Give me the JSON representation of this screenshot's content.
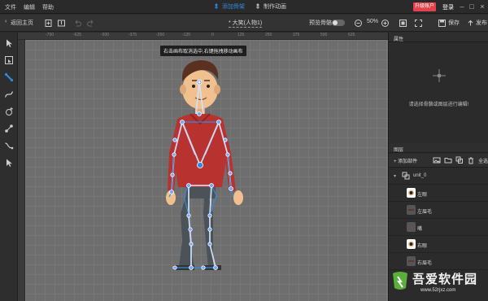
{
  "menu": {
    "file": "文件",
    "edit": "编辑",
    "help": "帮助"
  },
  "modes": {
    "add_skeleton": "添加骨架",
    "make_animation": "制作动画"
  },
  "account": {
    "upgrade": "升级账户",
    "login": "登录"
  },
  "toolbar": {
    "back": "返回主页",
    "doc_title": "* 大笑(人物1)",
    "preview_label": "预览骨骼",
    "zoom": "50%",
    "save": "保存",
    "publish": "发布"
  },
  "ruler": {
    "ticks": [
      "-750",
      "-625",
      "-500",
      "-375",
      "-250",
      "-125",
      "0",
      "125",
      "250",
      "375",
      "500",
      "625"
    ]
  },
  "tooltip": "右击画布取消选中,右键拖拽移动画布",
  "panels": {
    "properties": "属性",
    "props_hint": "请选择骨骼或图层进行编辑!",
    "layers": "图层",
    "add_part": "添加部件",
    "select_all": "全选"
  },
  "layers": [
    {
      "name": "unit_0",
      "thumb": "group"
    },
    {
      "name": "左眼",
      "thumb": "eye"
    },
    {
      "name": "左眉毛",
      "thumb": "brow"
    },
    {
      "name": "嘴",
      "thumb": "mouth"
    },
    {
      "name": "右眼",
      "thumb": "eye"
    },
    {
      "name": "右眉毛",
      "thumb": "brow"
    }
  ],
  "watermark": {
    "title": "吾爱软件园",
    "url": "www.52rjxz.com"
  },
  "colors": {
    "accent": "#2f8be0",
    "upgrade": "#e2424b",
    "shirt": "#b8332f",
    "pants": "#4b5358",
    "skin": "#f0c08e",
    "hair": "#5a3020"
  }
}
